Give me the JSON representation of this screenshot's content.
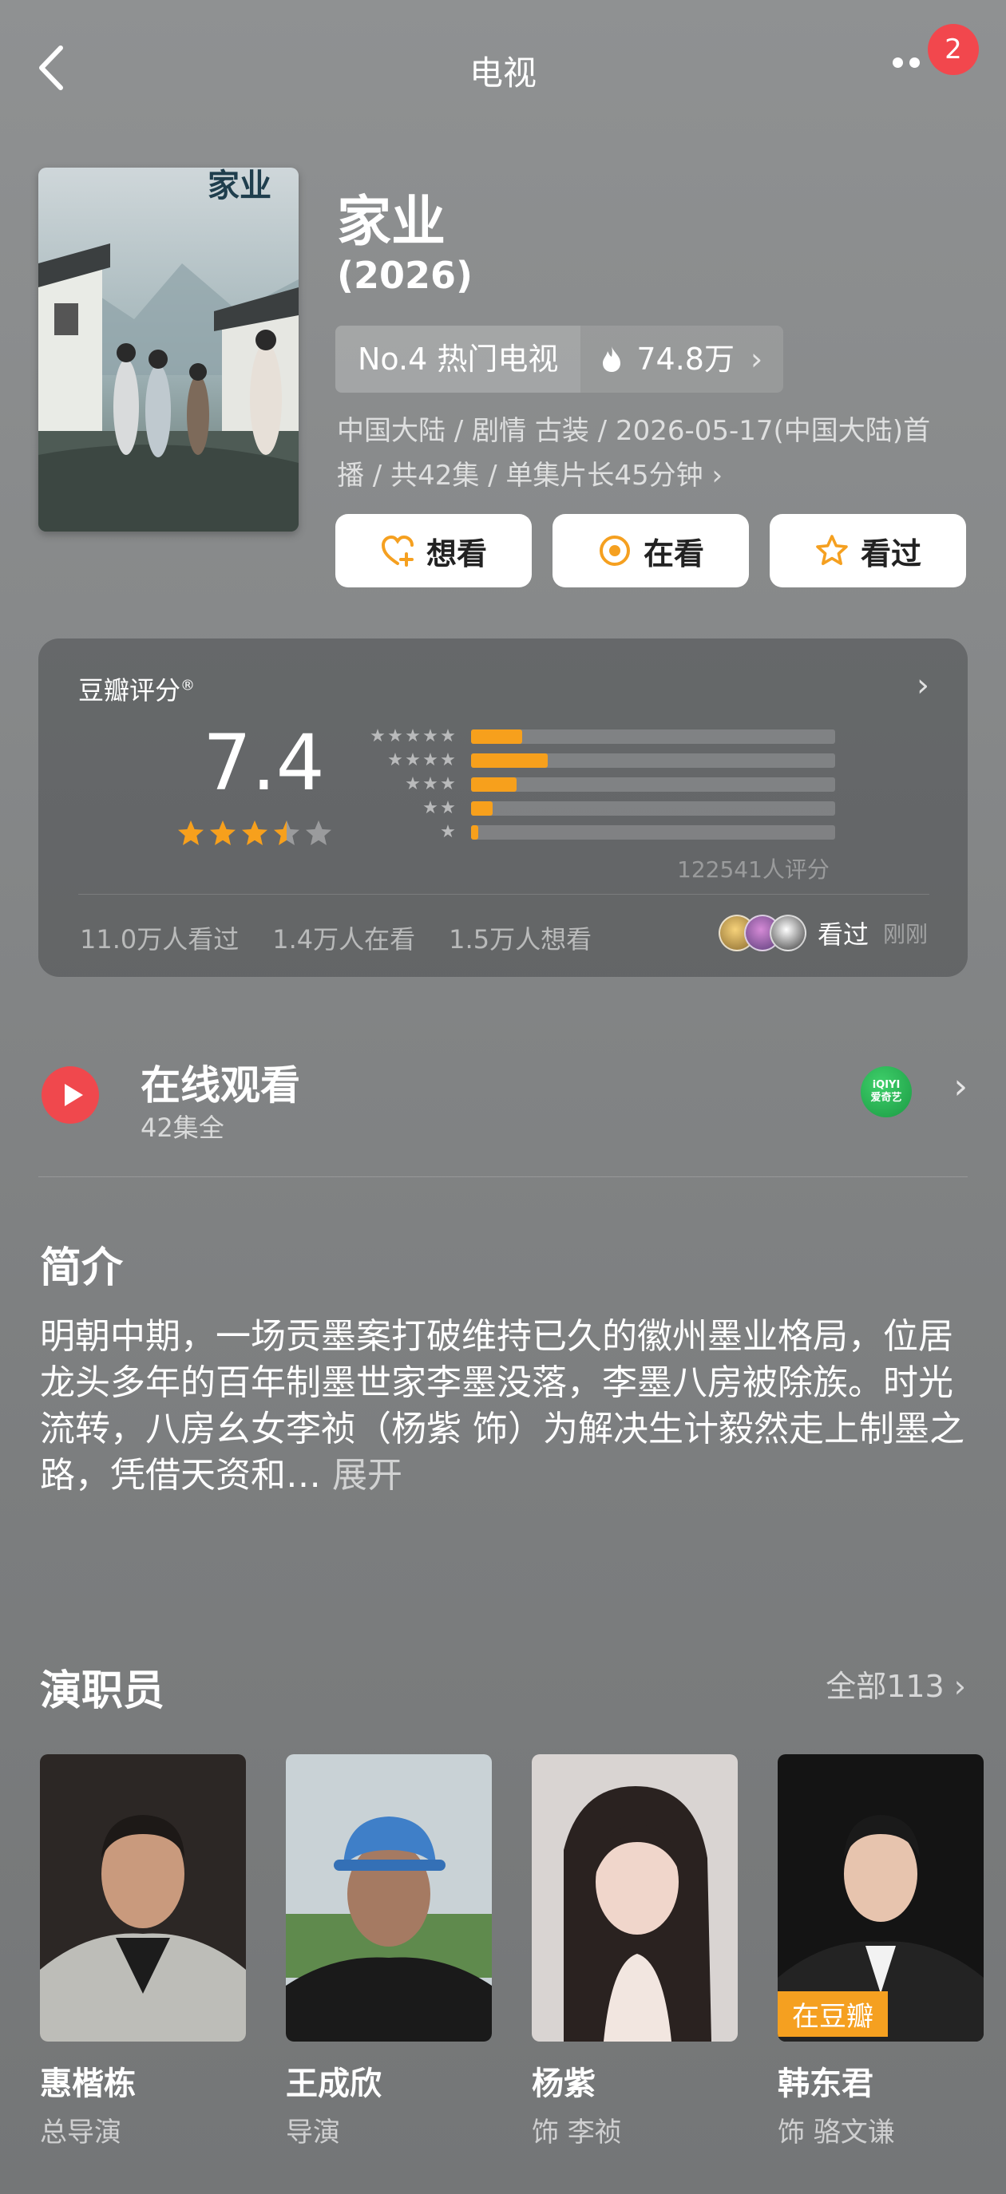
{
  "header": {
    "title": "电视",
    "badge": "2"
  },
  "show": {
    "title": "家业",
    "poster_text": "家业",
    "year": "(2026)",
    "rank_label": "No.4 热门电视",
    "heat": "74.8万",
    "meta_line1": "中国大陆 / 剧情 古装 / 2026-05-17(中国大陆)首",
    "meta_line2": "播 / 共42集 / 单集片长45分钟",
    "meta_chevron": "›"
  },
  "actions": [
    {
      "label": "想看",
      "icon": "heart-plus-icon"
    },
    {
      "label": "在看",
      "icon": "target-icon"
    },
    {
      "label": "看过",
      "icon": "star-outline-icon"
    }
  ],
  "rating": {
    "label": "豆瓣评分",
    "registered_mark": "®",
    "score": "7.4",
    "stars": 3.5,
    "distribution": [
      {
        "stars": 5,
        "fraction": 0.14
      },
      {
        "stars": 4,
        "fraction": 0.21
      },
      {
        "stars": 3,
        "fraction": 0.125
      },
      {
        "stars": 2,
        "fraction": 0.06
      },
      {
        "stars": 1,
        "fraction": 0.02
      }
    ],
    "count_text": "122541人评分",
    "watched": "11.0万人看过",
    "watching": "1.4万人在看",
    "want": "1.5万人想看",
    "friend_status": "看过",
    "friend_time": "刚刚",
    "accent": "#f7a01c"
  },
  "watch": {
    "title": "在线观看",
    "subtitle": "42集全",
    "platform_line1": "iQIYI",
    "platform_line2": "爱奇艺"
  },
  "synopsis": {
    "title": "简介",
    "text": "明朝中期，一场贡墨案打破维持已久的徽州墨业格局，位居龙头多年的百年制墨世家李墨没落，李墨八房被除族。时光流转，八房幺女李祯（杨紫 饰）为解决生计毅然走上制墨之路，凭借天资和…",
    "expand": "展开"
  },
  "cast": {
    "title": "演职员",
    "see_all": "全部113",
    "members": [
      {
        "name": "惠楷栋",
        "role": "总导演",
        "tag": ""
      },
      {
        "name": "王成欣",
        "role": "导演",
        "tag": ""
      },
      {
        "name": "杨紫",
        "role": "饰 李祯",
        "tag": ""
      },
      {
        "name": "韩东君",
        "role": "饰 骆文谦",
        "tag": "在豆瓣"
      }
    ]
  }
}
